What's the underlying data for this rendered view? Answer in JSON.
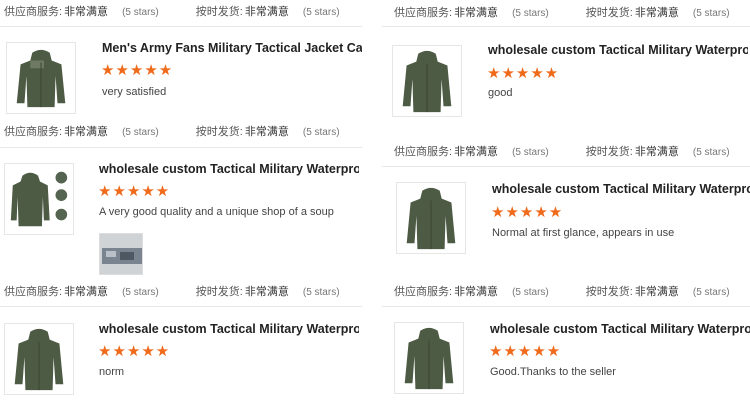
{
  "labels": {
    "supplier_service": "供应商服务:",
    "on_time_shipping": "按时发货:",
    "very_satisfied_cn": "非常满意",
    "five_stars": "(5 stars)",
    "star_row": "★★★★★"
  },
  "reviews": [
    {
      "title": "Men's Army Fans Military Tactical Jacket Camo...",
      "comment": "very satisfied",
      "rating": 5
    },
    {
      "title": "wholesale custom Tactical Military Waterproof ...",
      "comment": "good",
      "rating": 5
    },
    {
      "title": "wholesale custom Tactical Military Waterproof ...",
      "comment": "A very good quality and a unique shop of a soup",
      "rating": 5
    },
    {
      "title": "wholesale custom Tactical Military Waterproof ...",
      "comment": "Normal at first glance, appears in use",
      "rating": 5
    },
    {
      "title": "wholesale custom Tactical Military Waterproof ...",
      "comment": "norm",
      "rating": 5
    },
    {
      "title": "wholesale custom Tactical Military Waterproof ...",
      "comment": "Good.Thanks to the seller",
      "rating": 5
    }
  ],
  "colors": {
    "star": "#f06a1b",
    "jacket": "#4d5b45"
  }
}
